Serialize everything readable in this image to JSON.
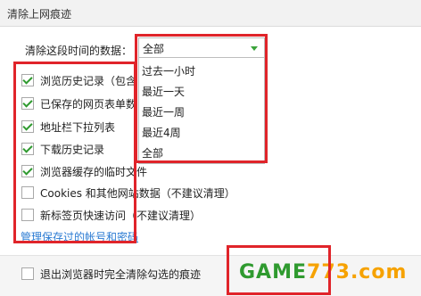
{
  "window": {
    "title": "清除上网痕迹"
  },
  "time_range": {
    "label": "清除这段时间的数据：",
    "selected": "全部",
    "options": [
      "过去一小时",
      "最近一天",
      "最近一周",
      "最近4周",
      "全部"
    ]
  },
  "checkboxes": [
    {
      "label": "浏览历史记录（包含",
      "checked": true
    },
    {
      "label": "已保存的网页表单数",
      "checked": true
    },
    {
      "label": "地址栏下拉列表",
      "checked": true
    },
    {
      "label": "下载历史记录",
      "checked": true
    },
    {
      "label": "浏览器缓存的临时文件",
      "checked": true
    },
    {
      "label": "Cookies 和其他网站数据（不建议清理）",
      "checked": false
    },
    {
      "label": "新标签页快速访问（不建议清理）",
      "checked": false
    }
  ],
  "manage_link": "管理保存过的帐号和密码",
  "footer": {
    "exit_label": "退出浏览器时完全清除勾选的痕迹",
    "exit_checked": false,
    "watermark": "GAME773.com"
  },
  "colors": {
    "accent": "#2f9a2f",
    "highlight": "#e0242a",
    "link": "#2a7ad2"
  }
}
